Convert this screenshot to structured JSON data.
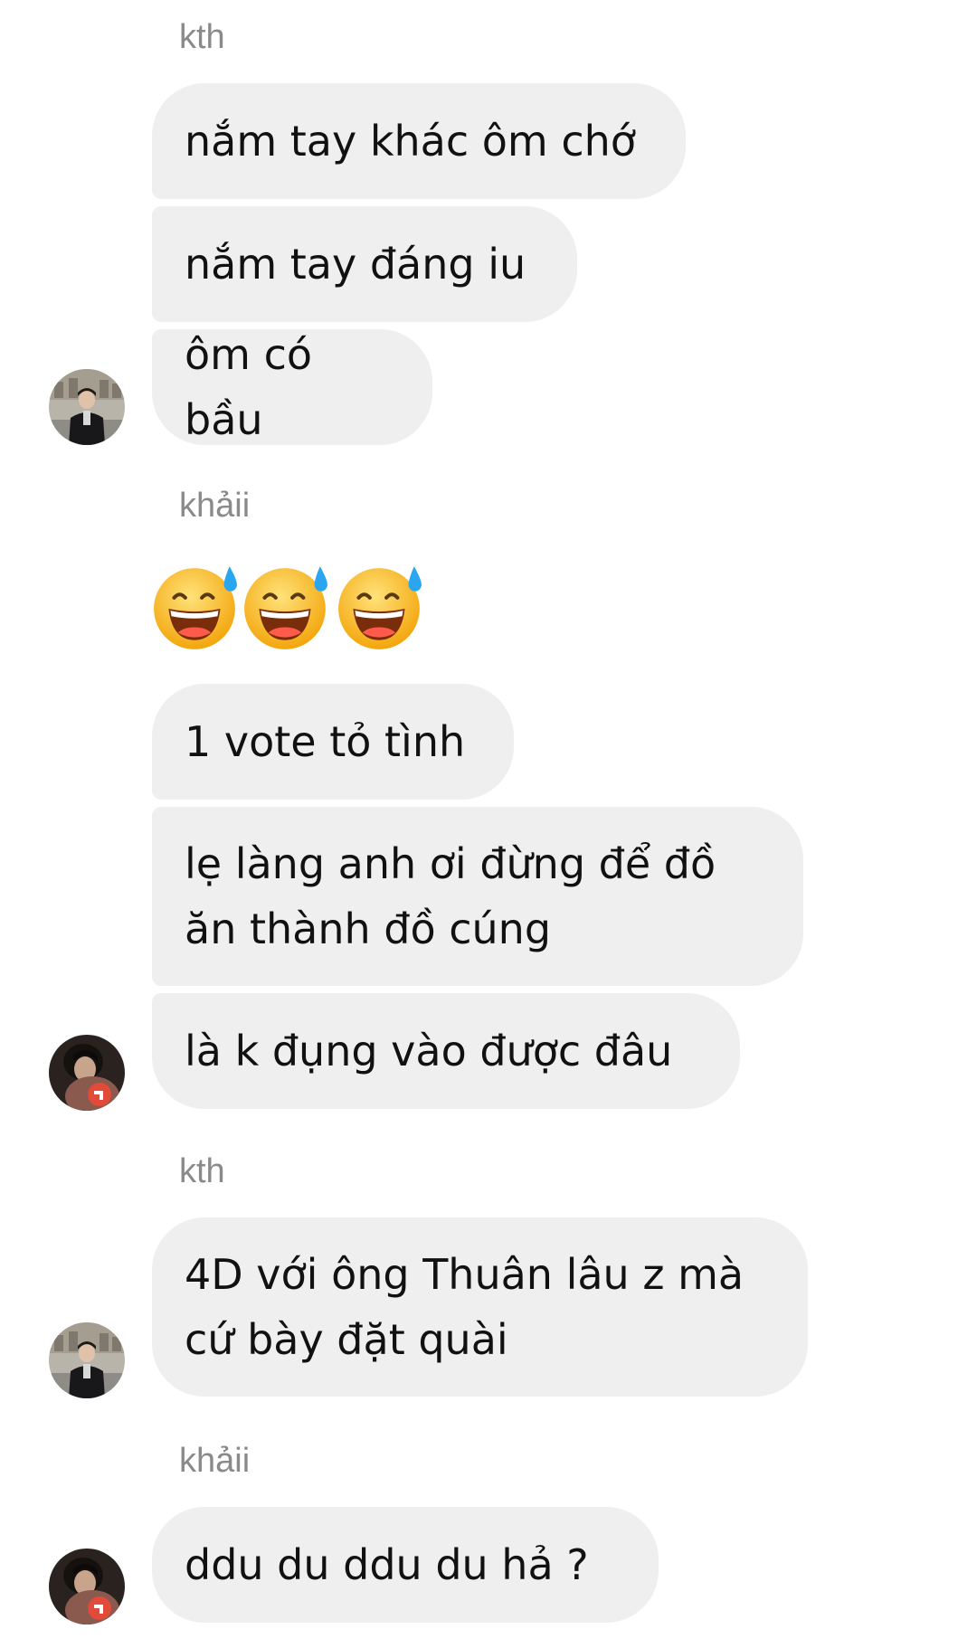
{
  "messages": [
    {
      "sender": "kth",
      "bubbles": [
        "nắm tay khác ôm chớ",
        "nắm tay đáng iu",
        "ôm có bầu"
      ]
    },
    {
      "sender": "khảii",
      "emoji": {
        "icon": "grinning-face-with-sweat-icon",
        "count": 3
      },
      "bubbles": [
        "1 vote tỏ tình",
        "lẹ làng anh ơi đừng để đồ\năn thành đồ cúng",
        "là k đụng vào được đâu"
      ]
    },
    {
      "sender": "kth",
      "bubbles": [
        "4D với ông Thuân lâu z mà\ncứ bày đặt quài"
      ]
    },
    {
      "sender": "khảii",
      "bubbles": [
        "ddu du ddu du hả ?"
      ]
    }
  ],
  "colors": {
    "bubble": "#efefef",
    "sender_name": "#8a8a8a",
    "message_text": "#111111",
    "background": "#ffffff"
  },
  "avatars": {
    "kth": "avatar-kth",
    "khaii": "avatar-khaii"
  }
}
